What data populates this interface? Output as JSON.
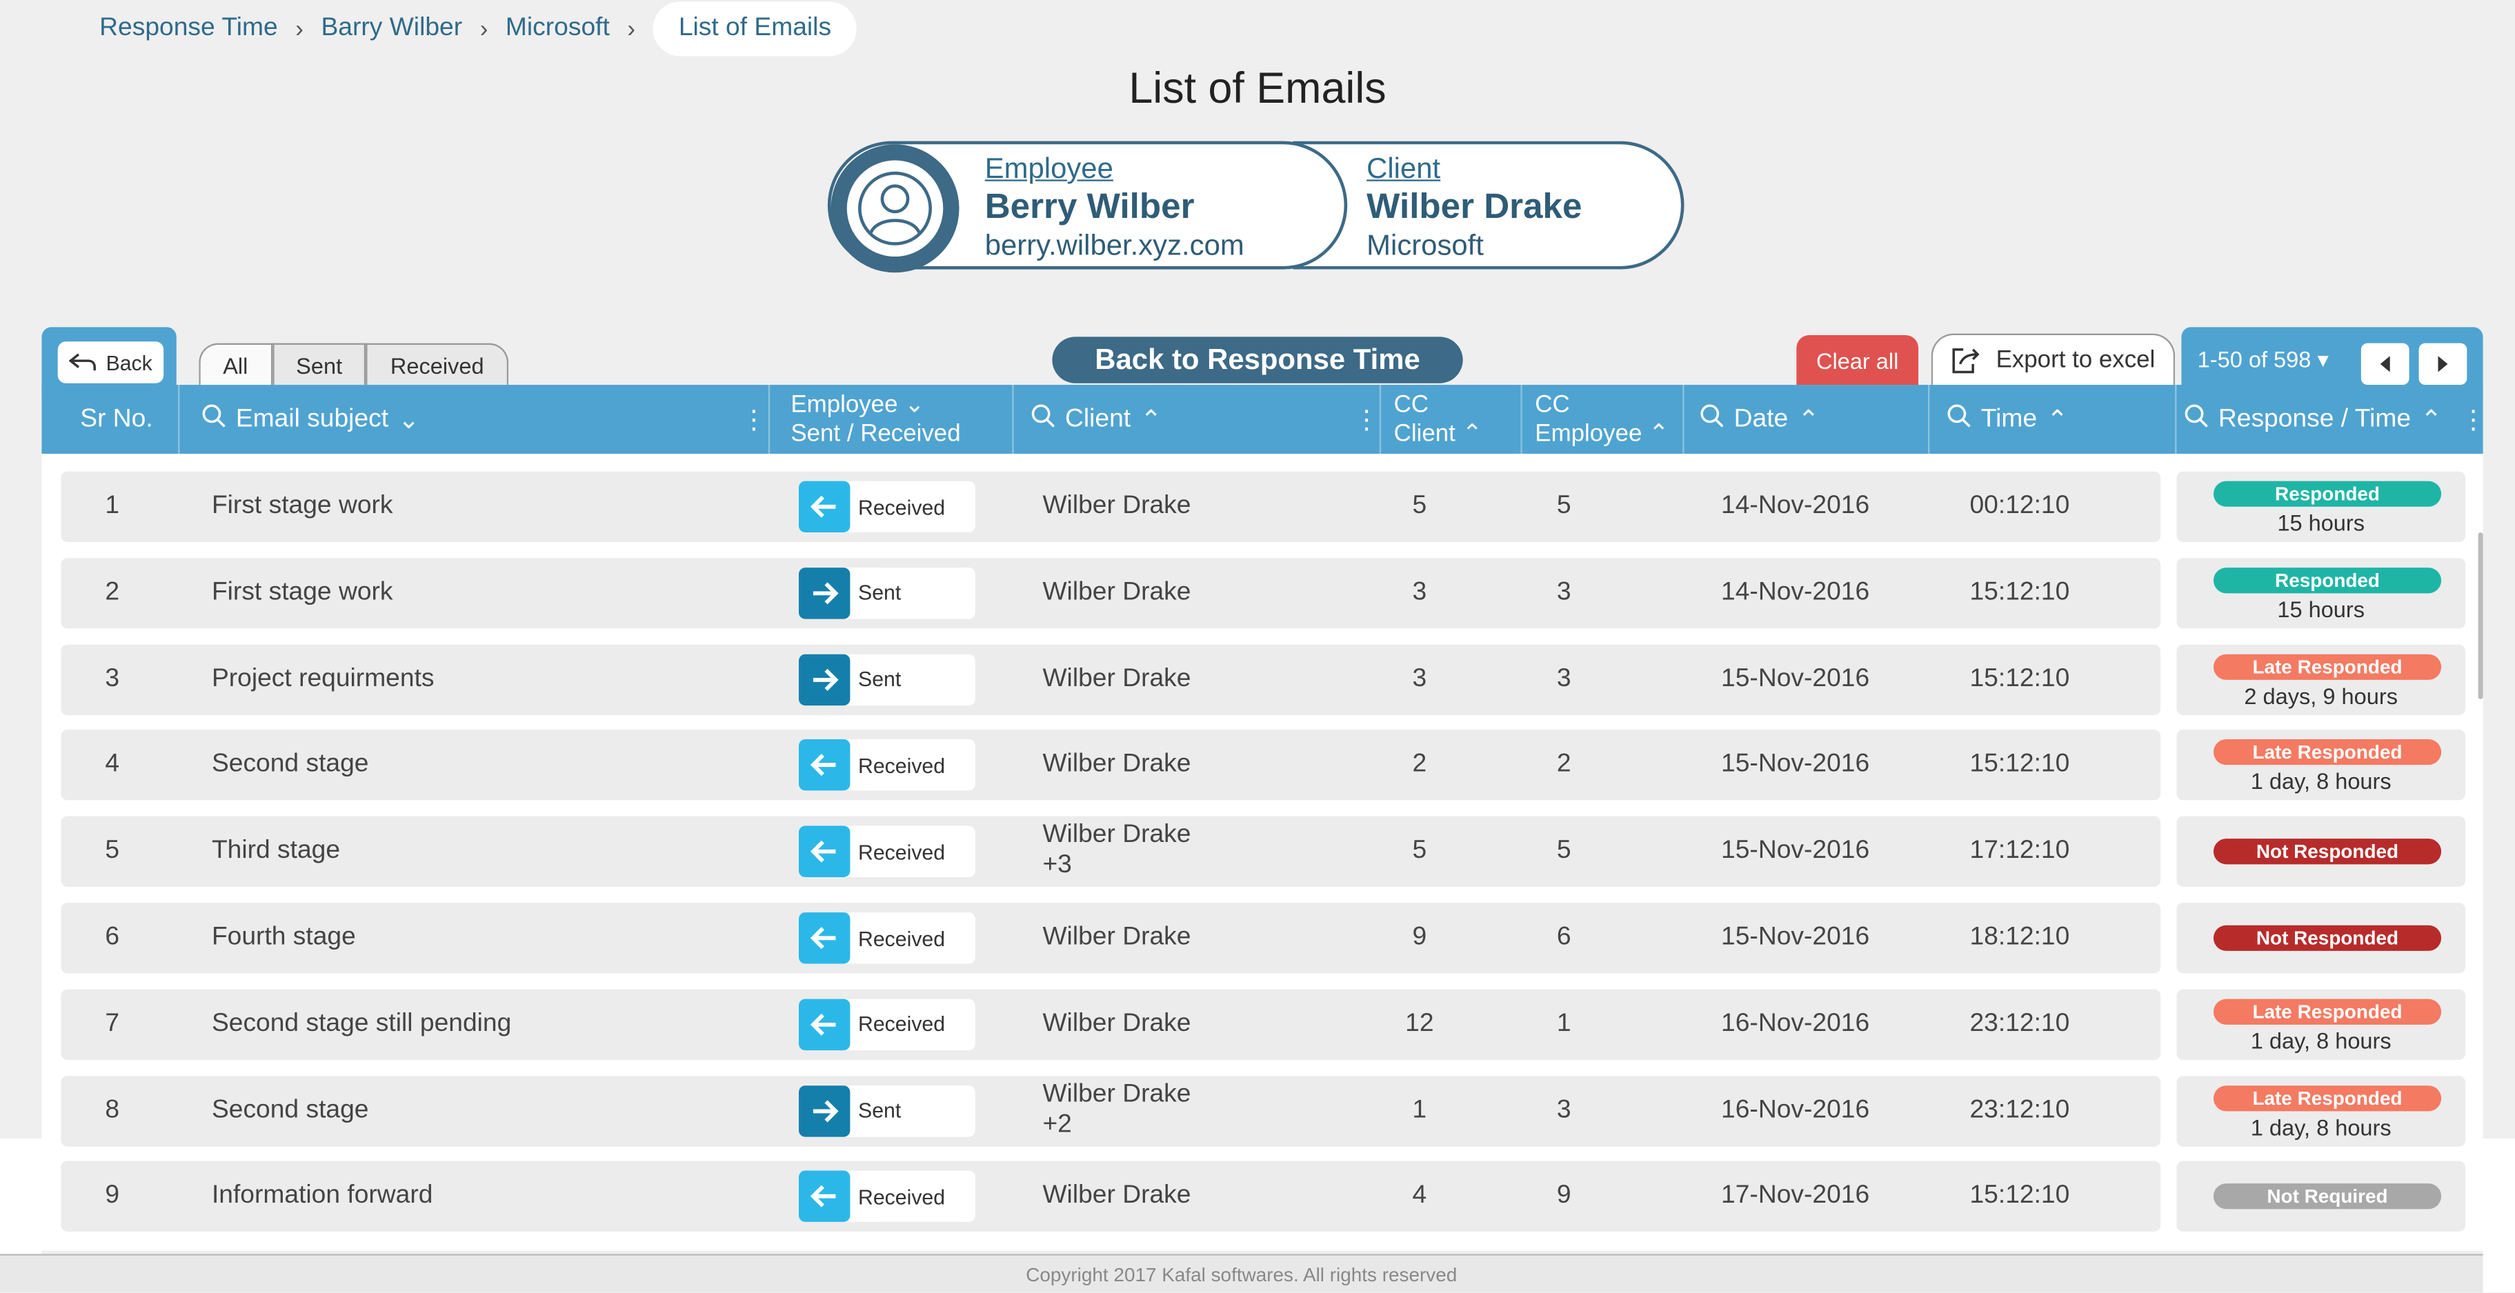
{
  "breadcrumb": {
    "items": [
      "Response Time",
      "Barry Wilber",
      "Microsoft"
    ],
    "current": "List of Emails"
  },
  "page_title": "List of Emails",
  "employee": {
    "label": "Employee",
    "name": "Berry Wilber",
    "email": "berry.wilber.xyz.com"
  },
  "client": {
    "label": "Client",
    "name": "Wilber Drake",
    "company": "Microsoft"
  },
  "toolbar": {
    "back_label": "Back",
    "tabs": [
      "All",
      "Sent",
      "Received"
    ],
    "back_to_rt": "Back to Response Time",
    "clear_all": "Clear all",
    "export": "Export to excel",
    "pager_range": "1-50 of 598"
  },
  "columns": {
    "sr": "Sr No.",
    "subject": "Email subject",
    "employee_line1": "Employee",
    "employee_line2": "Sent / Received",
    "client": "Client",
    "cc_client_line1": "CC",
    "cc_client_line2": "Client",
    "cc_emp_line1": "CC",
    "cc_emp_line2": "Employee",
    "date": "Date",
    "time": "Time",
    "response": "Response / Time"
  },
  "rows": [
    {
      "sr": "1",
      "subject": "First stage work",
      "dir": "Received",
      "client": "Wilber Drake",
      "client_extra": "",
      "cc_client": "5",
      "cc_emp": "5",
      "date": "14-Nov-2016",
      "time": "00:12:10",
      "status": "Responded",
      "resp_time": "15 hours"
    },
    {
      "sr": "2",
      "subject": "First stage work",
      "dir": "Sent",
      "client": "Wilber Drake",
      "client_extra": "",
      "cc_client": "3",
      "cc_emp": "3",
      "date": "14-Nov-2016",
      "time": "15:12:10",
      "status": "Responded",
      "resp_time": "15 hours"
    },
    {
      "sr": "3",
      "subject": "Project requirments",
      "dir": "Sent",
      "client": "Wilber Drake",
      "client_extra": "",
      "cc_client": "3",
      "cc_emp": "3",
      "date": "15-Nov-2016",
      "time": "15:12:10",
      "status": "Late Responded",
      "resp_time": "2 days, 9 hours"
    },
    {
      "sr": "4",
      "subject": "Second stage",
      "dir": "Received",
      "client": "Wilber Drake",
      "client_extra": "",
      "cc_client": "2",
      "cc_emp": "2",
      "date": "15-Nov-2016",
      "time": "15:12:10",
      "status": "Late Responded",
      "resp_time": "1 day, 8 hours"
    },
    {
      "sr": "5",
      "subject": "Third stage",
      "dir": "Received",
      "client": "Wilber Drake",
      "client_extra": "+3",
      "cc_client": "5",
      "cc_emp": "5",
      "date": "15-Nov-2016",
      "time": "17:12:10",
      "status": "Not Responded",
      "resp_time": ""
    },
    {
      "sr": "6",
      "subject": "Fourth stage",
      "dir": "Received",
      "client": "Wilber Drake",
      "client_extra": "",
      "cc_client": "9",
      "cc_emp": "6",
      "date": "15-Nov-2016",
      "time": "18:12:10",
      "status": "Not Responded",
      "resp_time": ""
    },
    {
      "sr": "7",
      "subject": "Second stage still pending",
      "dir": "Received",
      "client": "Wilber Drake",
      "client_extra": "",
      "cc_client": "12",
      "cc_emp": "1",
      "date": "16-Nov-2016",
      "time": "23:12:10",
      "status": "Late Responded",
      "resp_time": "1 day, 8 hours"
    },
    {
      "sr": "8",
      "subject": "Second stage",
      "dir": "Sent",
      "client": "Wilber Drake",
      "client_extra": "+2",
      "cc_client": "1",
      "cc_emp": "3",
      "date": "16-Nov-2016",
      "time": "23:12:10",
      "status": "Late Responded",
      "resp_time": "1 day, 8 hours"
    },
    {
      "sr": "9",
      "subject": "Information forward",
      "dir": "Received",
      "client": "Wilber Drake",
      "client_extra": "",
      "cc_client": "4",
      "cc_emp": "9",
      "date": "17-Nov-2016",
      "time": "15:12:10",
      "status": "Not Required",
      "resp_time": ""
    }
  ],
  "status_colors": {
    "Responded": "#1fb5a5",
    "Late Responded": "#f47a62",
    "Not Responded": "#b82b2b",
    "Not Required": "#a8a8a8"
  },
  "footer": "Copyright 2017 Kafal softwares. All rights reserved"
}
